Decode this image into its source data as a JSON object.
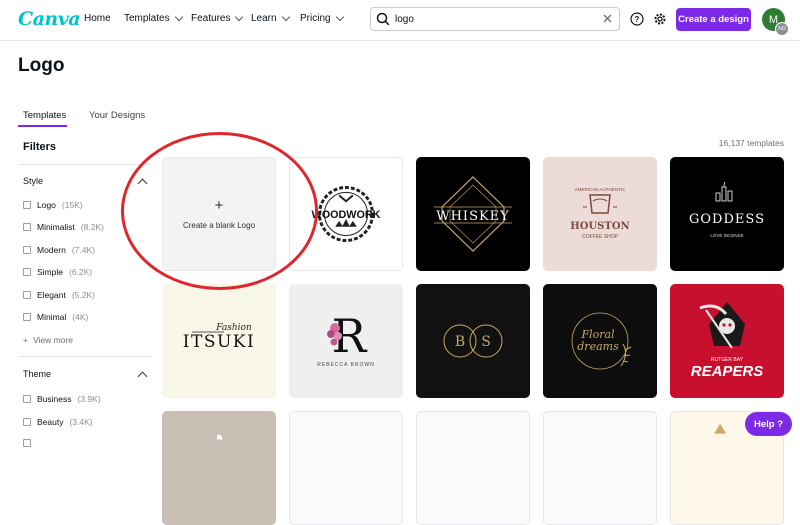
{
  "nav": {
    "logo": "Canva",
    "items": [
      {
        "label": "Home",
        "dropdown": false
      },
      {
        "label": "Templates",
        "dropdown": true
      },
      {
        "label": "Features",
        "dropdown": true
      },
      {
        "label": "Learn",
        "dropdown": true
      },
      {
        "label": "Pricing",
        "dropdown": true
      }
    ],
    "search_value": "logo",
    "create_label": "Create a design",
    "avatar_initial": "M",
    "avatar_badge": "NO"
  },
  "page": {
    "title": "Logo",
    "tabs": [
      "Templates",
      "Your Designs"
    ],
    "template_count": "16,137 templates"
  },
  "sidebar": {
    "filters_label": "Filters",
    "style_label": "Style",
    "style_items": [
      {
        "label": "Logo",
        "count": "(15K)"
      },
      {
        "label": "Minimalist",
        "count": "(8.2K)"
      },
      {
        "label": "Modern",
        "count": "(7.4K)"
      },
      {
        "label": "Simple",
        "count": "(6.2K)"
      },
      {
        "label": "Elegant",
        "count": "(5.2K)"
      },
      {
        "label": "Minimal",
        "count": "(4K)"
      }
    ],
    "view_more": "View more",
    "theme_label": "Theme",
    "theme_items": [
      {
        "label": "Business",
        "count": "(3.9K)"
      },
      {
        "label": "Beauty",
        "count": "(3.4K)"
      }
    ]
  },
  "grid": {
    "blank_label": "Create a blank Logo",
    "cards": {
      "woodwork": "WOODWORK",
      "whiskey": "WHISKEY",
      "houston_small": "AMERICAN AUTHENTIC",
      "houston": "HOUSTON",
      "houston_sub": "COFFEE SHOP",
      "goddess": "GODDESS",
      "goddess_sub": "LOVE INCENSE",
      "itsuki_script": "Fashion",
      "itsuki": "ITSUKI",
      "rebecca_letter": "R",
      "rebecca": "REBECCA BROWN",
      "bs_left": "B",
      "bs_right": "S",
      "floral": "Floral",
      "floral2": "dreams",
      "reapers_top": "RUTGER BAY",
      "reapers": "REAPERS"
    }
  },
  "help_label": "Help ?",
  "colors": {
    "brand_purple": "#7d2ae8",
    "canva_teal": "#00c4cc",
    "annotation_red": "#e0262d"
  }
}
